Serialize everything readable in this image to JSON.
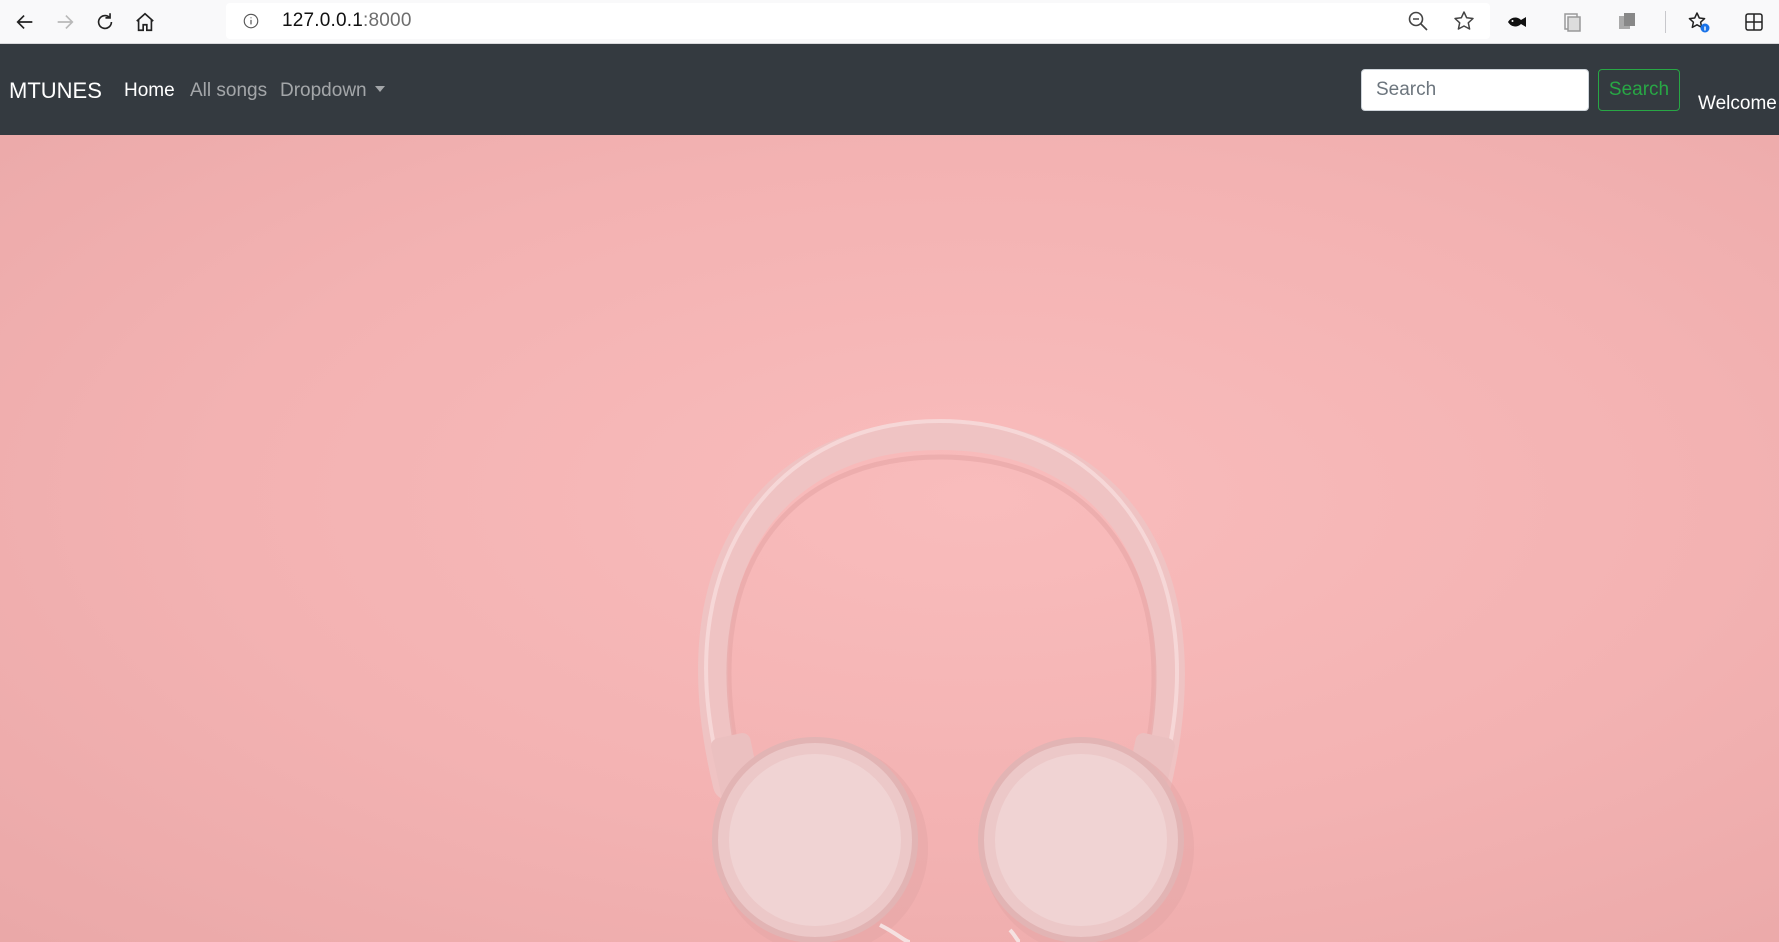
{
  "browser": {
    "url_host": "127.0.0.1",
    "url_port": ":8000",
    "icons": [
      "back-arrow-icon",
      "forward-arrow-icon",
      "reload-icon",
      "home-icon",
      "info-icon",
      "zoom-out-icon",
      "star-icon",
      "fish-extension-icon",
      "collections-icon",
      "copy-icon",
      "favorites-icon",
      "extensions-icon"
    ]
  },
  "navbar": {
    "brand": "MTUNES",
    "links": {
      "home": "Home",
      "all_songs": "All songs",
      "dropdown": "Dropdown"
    },
    "search": {
      "placeholder": "Search",
      "button_label": "Search"
    },
    "welcome": "Welcome"
  },
  "colors": {
    "navbar_bg": "#343a40",
    "search_button": "#28a745",
    "hero_bg": "#f4b4b4"
  }
}
